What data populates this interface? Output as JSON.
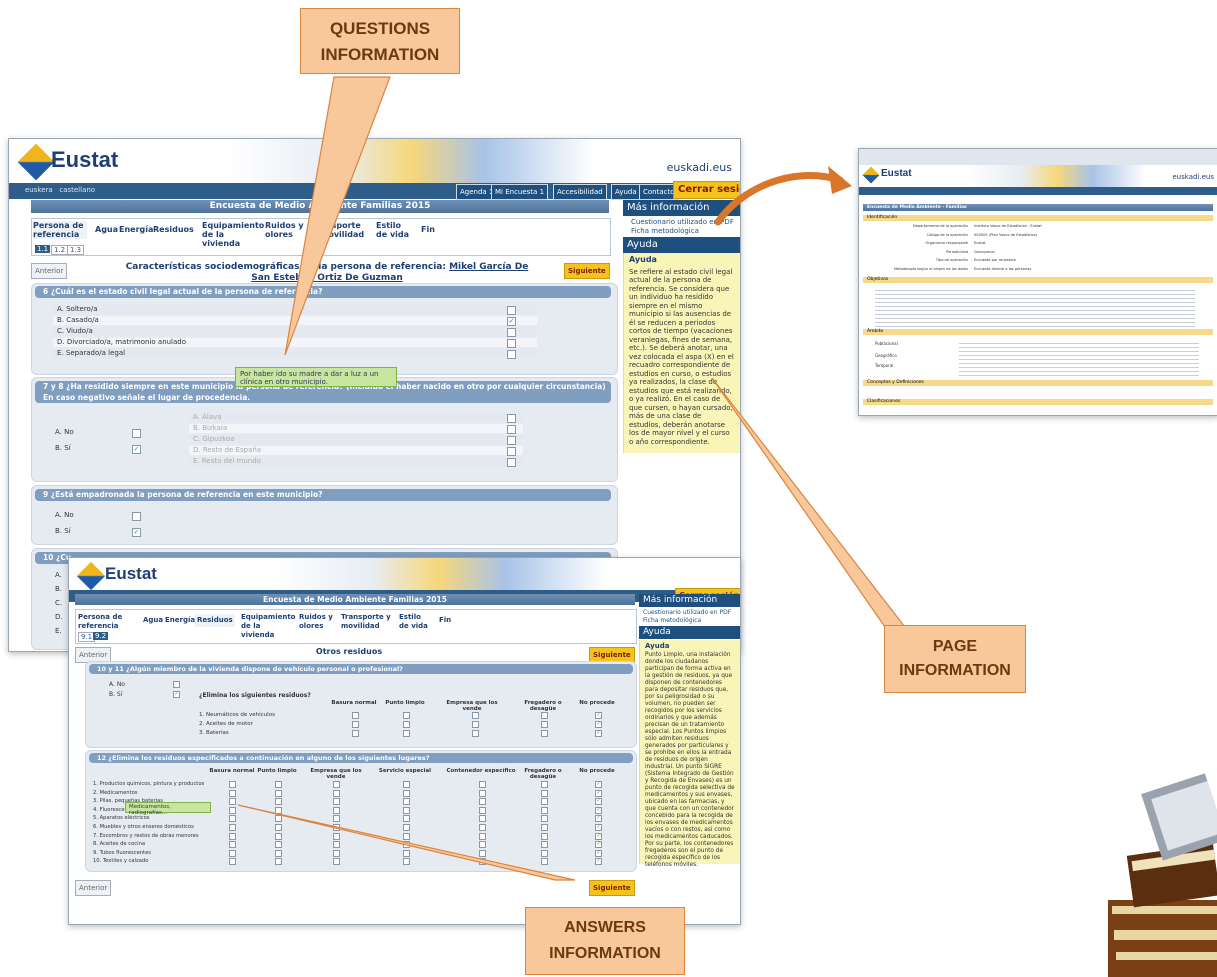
{
  "callouts": {
    "questions": "QUESTIONS INFORMATION",
    "page": "PAGE INFORMATION",
    "answers": "ANSWERS INFORMATION"
  },
  "colors": {
    "callout_fill": "#f8c79a",
    "accent": "#f6c21c",
    "header_blue": "#2f5d8a"
  },
  "main": {
    "logo": "Eustat",
    "euskadi": "euskadi.eus",
    "nav_left": "euskera   castellano",
    "nav_buttons": [
      "Agenda 1",
      "Mi Encuesta 1",
      "Accesibilidad",
      "Ayuda",
      "Contacto"
    ],
    "close_session": "Cerrar sesión",
    "title": "Encuesta de Medio Ambiente Familias 2015",
    "tabs": [
      "Persona de referencia",
      "Agua",
      "Energía",
      "Residuos",
      "Equipamiento de la vivienda",
      "Ruidos y olores",
      "Transporte y movilidad",
      "Estilo de vida",
      "Fin"
    ],
    "subtabs": [
      "1.1",
      "1.2",
      "1.3"
    ],
    "prev": "Anterior",
    "next": "Siguiente",
    "section_title": "Características sociodemográficas de la persona de referencia:",
    "person": "Mikel García De San Esteban Ortiz De Guzman",
    "q6": "6 ¿Cuál es el estado civil legal actual de la persona de referencia?",
    "q6_options": [
      "A. Soltero/a",
      "B. Casado/a",
      "C. Viudo/a",
      "D. Divorciado/a, matrimonio anulado",
      "E. Separado/a legal"
    ],
    "tooltip": "Por haber ido su madre a dar a luz a un clínica en otro municipio.",
    "q7": "7 y 8 ¿Ha residido siempre en este municipio la persona de referencia? (Incluido el haber nacido en otro por cualquier circunstancia) En caso negativo señale el lugar de procedencia.",
    "q7_options": [
      "A. No",
      "B. Sí"
    ],
    "q7_places": [
      "A. Álava",
      "B. Bizkaia",
      "C. Gipuzkoa",
      "D. Resto de España",
      "E. Resto del mundo"
    ],
    "q9": "9 ¿Está empadronada la persona de referencia en este municipio?",
    "q9_options": [
      "A. No",
      "B. Sí"
    ],
    "q10": "10 ¿Cu",
    "q10_letters": [
      "A.",
      "B.",
      "C.",
      "D.",
      "E."
    ],
    "side_title": "Más información",
    "side_links": [
      "Cuestionario utilizado en PDF",
      "Ficha metodológica"
    ],
    "help_header": "Ayuda",
    "help_title": "Ayuda",
    "help_text": "Se refiere al estado civil legal actual de la persona de referencia. Se considera que un individuo ha residido siempre en el mismo municipio si las ausencias de él se reducen a periodos cortos de tiempo (vacaciones veraniegas, fines de semana, etc.). Se deberá anotar, una vez colocada el aspa (X) en el recuadro correspondiente de estudios en curso, o estudios ya realizados, la clase de estudios que está realizando, o ya realizó. En el caso de que cursen, o hayan cursado, más de una clase de estudios, deberán anotarse los de mayor nivel y el curso o año correspondiente."
  },
  "second": {
    "logo": "Eustat",
    "title": "Encuesta de Medio Ambiente Familias 2015",
    "tabs": [
      "Persona de referencia",
      "Agua",
      "Energía",
      "Residuos",
      "Equipamiento de la vivienda",
      "Ruidos y olores",
      "Transporte y movilidad",
      "Estilo de vida",
      "Fin"
    ],
    "subtabs": [
      "9.1",
      "9.2"
    ],
    "prev": "Anterior",
    "section_title": "Otros residuos",
    "next": "Siguiente",
    "q10": "10 y 11 ¿Algún miembro de la vivienda dispone de vehículo personal o profesional?",
    "q10_options": [
      "A. No",
      "B. Sí"
    ],
    "q10_sub": "¿Elimina los siguientes residuos?",
    "q10_cols": [
      "Basura normal",
      "Punto limpio",
      "Empresa que los vende",
      "Fregadero o desagüe",
      "No procede"
    ],
    "q10_rows": [
      "1. Neumáticos de vehículos",
      "2. Aceites de motor",
      "3. Baterías"
    ],
    "q12": "12 ¿Elimina los residuos especificados a continuación en alguno de los siguientes lugares?",
    "q12_cols": [
      "Basura normal",
      "Punto limpio",
      "Empresa que los vende",
      "Servicio especial",
      "Contenedor específico",
      "Fregadero o desagüe",
      "No procede"
    ],
    "q12_rows": [
      "1. Productos químicos, pintura y productos de limpieza",
      "2. Medicamentos",
      "3. Pilas, pequeñas baterías",
      "4. Fluorescentes, bombillas",
      "5. Aparatos eléctricos",
      "6. Muebles y otros enseres domésticos",
      "7. Escombros y restos de obras menores",
      "8. Aceites de cocina",
      "9. Tubos fluorescentes",
      "10. Textiles y calzado"
    ],
    "tooltip": "Medicamentos, radiografías...",
    "side_title": "Más información",
    "side_links": [
      "Cuestionario utilizado en PDF",
      "Ficha metodológica"
    ],
    "help_header": "Ayuda",
    "help_title": "Ayuda",
    "help_text": "Punto Limpio, una instalación donde los ciudadanos participan de forma activa en la gestión de residuos, ya que disponen de contenedores para depositar residuos que, por su peligrosidad o su volumen, no pueden ser recogidos por los servicios ordinarios y que además precisan de un tratamiento especial. Los Puntos limpios sólo admiten residuos generados por particulares y se prohíbe en ellos la entrada de residuos de origen industrial. Un punto SIGRE (Sistema Integrado de Gestión y Recogida de Envases) es un punto de recogida selectiva de medicamentos y sus envases, ubicado en las farmacias, y que cuenta con un contenedor concebido para la recogida de los envases de medicamentos vacíos o con restos, así como los medicamentos caducados. Por su parte, los contenedores fregaderos son el punto de recogida específico de los teléfonos móviles."
  },
  "third": {
    "logo": "Eustat",
    "euskadi": "euskadi.eus",
    "title": "Encuesta de Medio Ambiente - Familias",
    "sections": [
      "Identificación",
      "Objetivos",
      "Ámbito",
      "Conceptos y Definiciones",
      "Clasificaciones"
    ],
    "id_labels": [
      "Departamento de la operación",
      "Código de la operación",
      "Organismo responsable",
      "Periodicidad",
      "Tipo de operación",
      "Metodología según el origen de los datos"
    ],
    "id_values": [
      "Instituto Vasco de Estadística - Eustat",
      "050005 (Plan Vasco de Estadística)",
      "Eustat",
      "Quinquenal",
      "Encuesta por muestreo",
      "Encuesta directa a las personas"
    ],
    "ambito_labels": [
      "Poblacional",
      "Geográfico",
      "Temporal"
    ]
  }
}
